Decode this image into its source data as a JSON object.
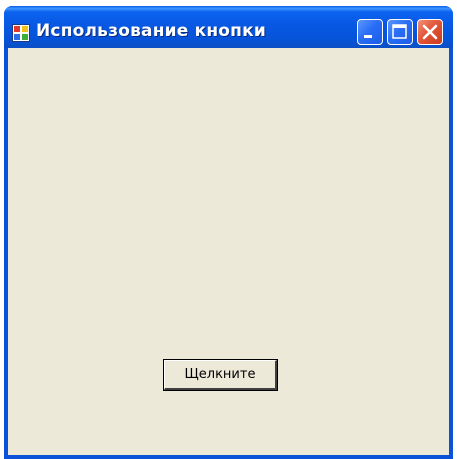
{
  "window": {
    "title": "Использование кнопки",
    "icon": "app-window-icon",
    "caption_buttons": [
      "minimize-icon",
      "maximize-icon",
      "close-icon"
    ]
  },
  "client": {
    "button_label": "Щелкните"
  },
  "colors": {
    "titlebar": "#0858e3",
    "client_background": "#ece9d8",
    "close_button": "#e2563a"
  }
}
